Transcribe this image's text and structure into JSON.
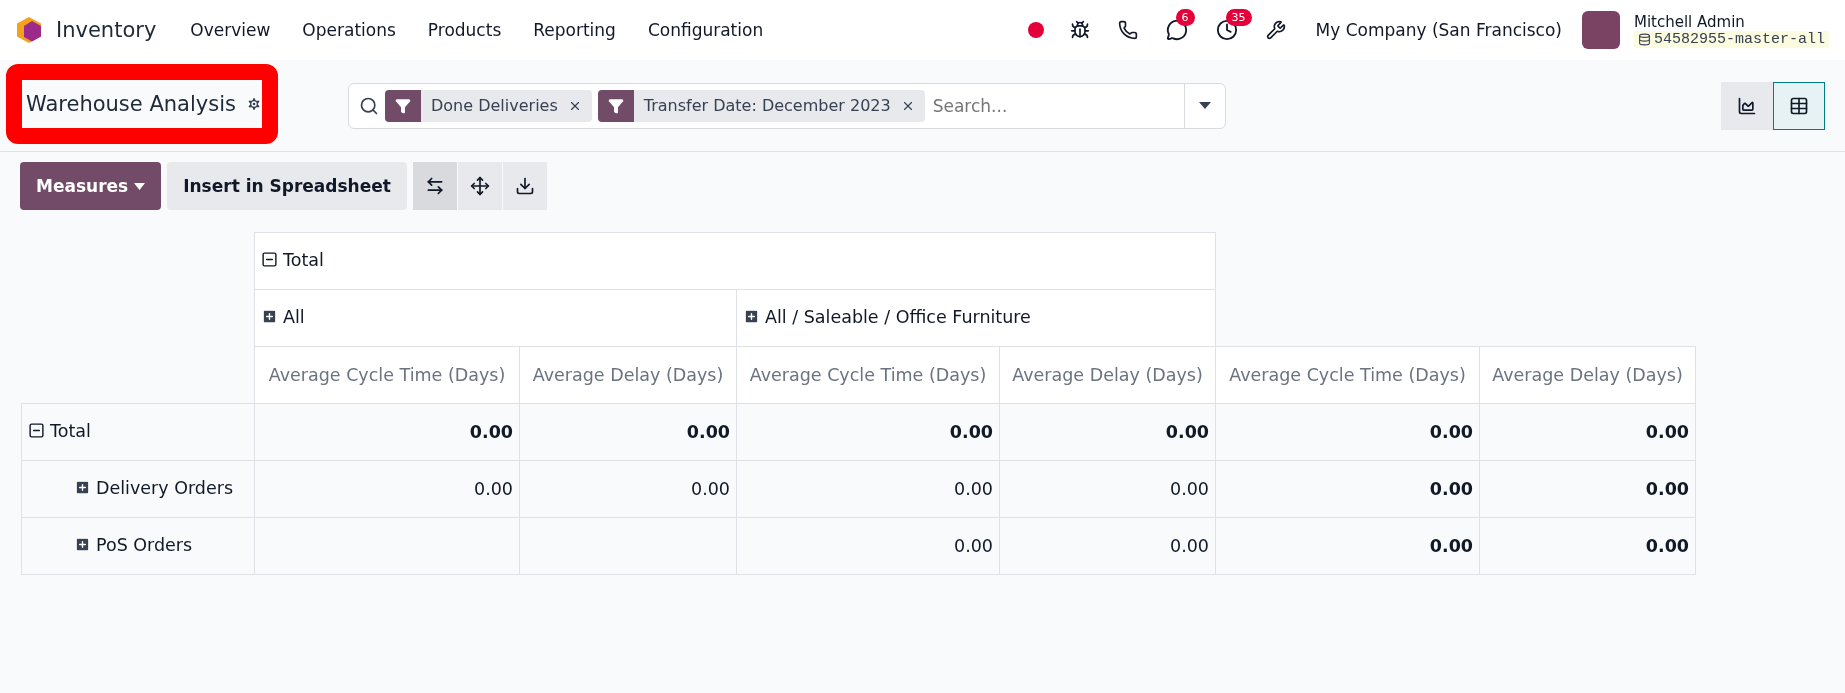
{
  "navbar": {
    "app": "Inventory",
    "menu": [
      "Overview",
      "Operations",
      "Products",
      "Reporting",
      "Configuration"
    ],
    "chat_count": "6",
    "activity_count": "35",
    "company": "My Company (San Francisco)",
    "user": "Mitchell Admin",
    "database": "54582955-master-all"
  },
  "title": {
    "text": "Warehouse Analysis",
    "highlighted": true
  },
  "search": {
    "facets": [
      "Done Deliveries",
      "Transfer Date: December 2023"
    ],
    "placeholder": "Search..."
  },
  "views": [
    {
      "kind": "graph",
      "selected": false
    },
    {
      "kind": "pivot",
      "selected": true
    }
  ],
  "toolbar": {
    "measures": "Measures",
    "insert": "Insert in Spreadsheet",
    "tools": [
      {
        "kind": "flip",
        "selected": true
      },
      {
        "kind": "expand",
        "selected": false
      },
      {
        "kind": "download",
        "selected": false
      }
    ]
  },
  "pivot": {
    "header": {
      "label": "Total",
      "expanded": true
    },
    "groups": [
      {
        "label": "All",
        "expanded": false
      },
      {
        "label": "All / Saleable / Office Furniture",
        "expanded": false
      }
    ],
    "measures": [
      {
        "label": "Average Cycle Time (Days)",
        "kind": "measure"
      },
      {
        "label": "Average Delay (Days)",
        "kind": "measure"
      },
      {
        "label": "Average Cycle Time (Days)",
        "kind": "measure"
      },
      {
        "label": "Average Delay (Days)",
        "kind": "measure"
      },
      {
        "label": "Average Cycle Time (Days)",
        "kind": "total"
      },
      {
        "label": "Average Delay (Days)",
        "kind": "total"
      }
    ],
    "rows": [
      {
        "label": "Total",
        "kind": "total",
        "expanded": true,
        "cells": [
          "0.00",
          "0.00",
          "0.00",
          "0.00",
          "0.00",
          "0.00"
        ]
      },
      {
        "label": "Delivery Orders",
        "kind": "group",
        "expanded": false,
        "cells": [
          "0.00",
          "0.00",
          "0.00",
          "0.00",
          "0.00",
          "0.00"
        ]
      },
      {
        "label": "PoS Orders",
        "kind": "group",
        "expanded": false,
        "cells": [
          null,
          null,
          "0.00",
          "0.00",
          "0.00",
          "0.00"
        ]
      }
    ]
  }
}
